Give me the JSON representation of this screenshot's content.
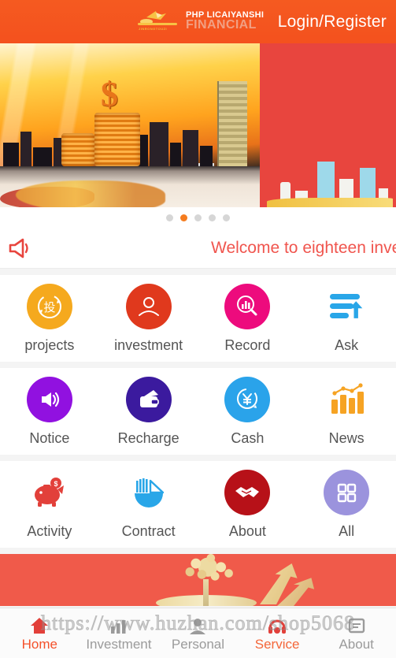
{
  "header": {
    "logo_line1": "PHP LICAIYANSHI",
    "logo_line2": "FINANCIAL",
    "logo_sub": "JINRONGTOUZI",
    "logo_icon": "bird-logo-icon",
    "login_label": "Login/Register",
    "bg_color": "#f4511e"
  },
  "banner": {
    "slide_count": 5,
    "active_index": 1,
    "slides": [
      {
        "name": "city-coins-sunset"
      },
      {
        "name": "red-buildings-panel"
      },
      {
        "name": "slide-3"
      },
      {
        "name": "slide-4"
      },
      {
        "name": "slide-5"
      }
    ]
  },
  "notice": {
    "icon": "megaphone-icon",
    "text": "Welcome to eighteen investment",
    "color": "#f0554e"
  },
  "grid": {
    "rows": [
      [
        {
          "label": "projects",
          "icon": "invest-char-circle-icon",
          "color": "#f5a91e"
        },
        {
          "label": "investment",
          "icon": "person-circle-icon",
          "color": "#e0391d"
        },
        {
          "label": "Record",
          "icon": "search-chart-circle-icon",
          "color": "#ed0b7d"
        },
        {
          "label": "Ask",
          "icon": "list-upload-icon",
          "color": "#29a6e8"
        }
      ],
      [
        {
          "label": "Notice",
          "icon": "speaker-circle-icon",
          "color": "#9111e0"
        },
        {
          "label": "Recharge",
          "icon": "wallet-circle-icon",
          "color": "#3b1a9e"
        },
        {
          "label": "Cash",
          "icon": "yen-circle-icon",
          "color": "#2aa3ea"
        },
        {
          "label": "News",
          "icon": "bar-chart-icon",
          "color": "#f6a323"
        }
      ],
      [
        {
          "label": "Activity",
          "icon": "piggy-bank-icon",
          "color": "#e2403a"
        },
        {
          "label": "Contract",
          "icon": "pie-chart-icon",
          "color": "#29a6e8"
        },
        {
          "label": "About",
          "icon": "handshake-circle-icon",
          "color": "#b71118"
        },
        {
          "label": "All",
          "icon": "grid-squares-circle-icon",
          "color": "#9b93dd"
        }
      ]
    ]
  },
  "promo": {
    "name": "money-tree-banner",
    "bg_color": "#f05a4a"
  },
  "watermark": {
    "text": "https://www.huzhan.com/shop5068"
  },
  "tabbar": {
    "items": [
      {
        "label": "Home",
        "icon": "home-icon",
        "state": "active"
      },
      {
        "label": "Investment",
        "icon": "chart-icon",
        "state": "normal"
      },
      {
        "label": "Personal",
        "icon": "person-icon",
        "state": "normal"
      },
      {
        "label": "Service",
        "icon": "headset-icon",
        "state": "alt"
      },
      {
        "label": "About",
        "icon": "info-icon",
        "state": "normal"
      }
    ]
  }
}
